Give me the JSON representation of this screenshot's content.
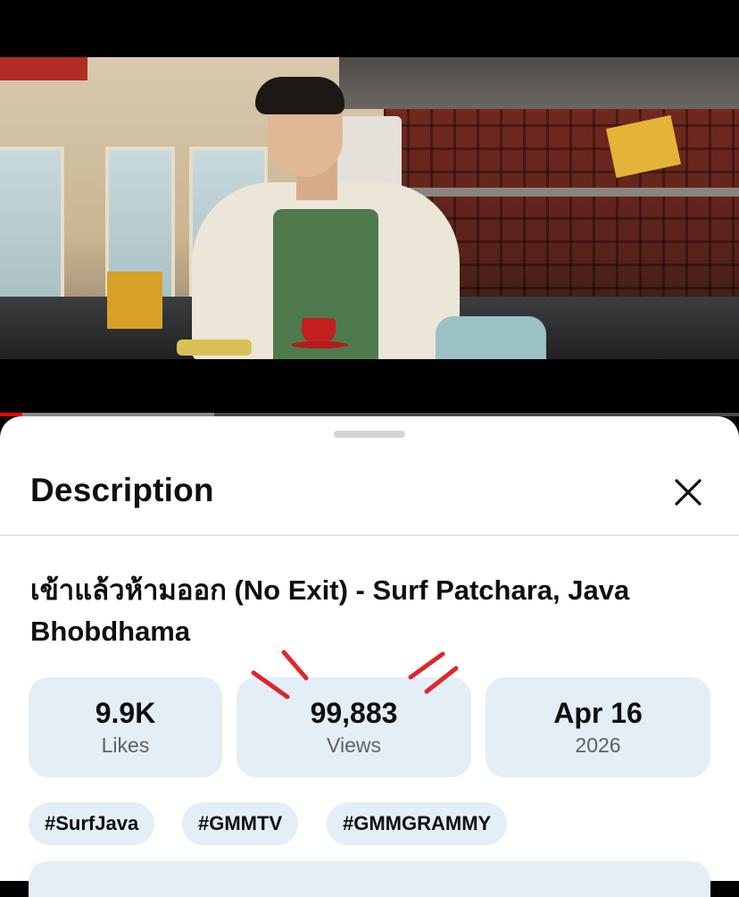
{
  "sheet": {
    "title": "Description",
    "close_icon": "close-icon"
  },
  "video": {
    "title": "เข้าแล้วห้ามออก (No Exit) - Surf Patchara, Java Bhobdhama",
    "progress_fraction": 0.03,
    "buffered_fraction": 0.29
  },
  "stats": {
    "likes": {
      "value": "9.9K",
      "label": "Likes"
    },
    "views": {
      "value": "99,883",
      "label": "Views"
    },
    "date": {
      "value": "Apr 16",
      "label": "2026"
    }
  },
  "hashtags": [
    "#SurfJava",
    "#GMMTV",
    "#GMMGRAMMY"
  ],
  "colors": {
    "accent_red": "#ff0000",
    "card_bg": "#e3eef7",
    "annotation_red": "#e0262b"
  }
}
